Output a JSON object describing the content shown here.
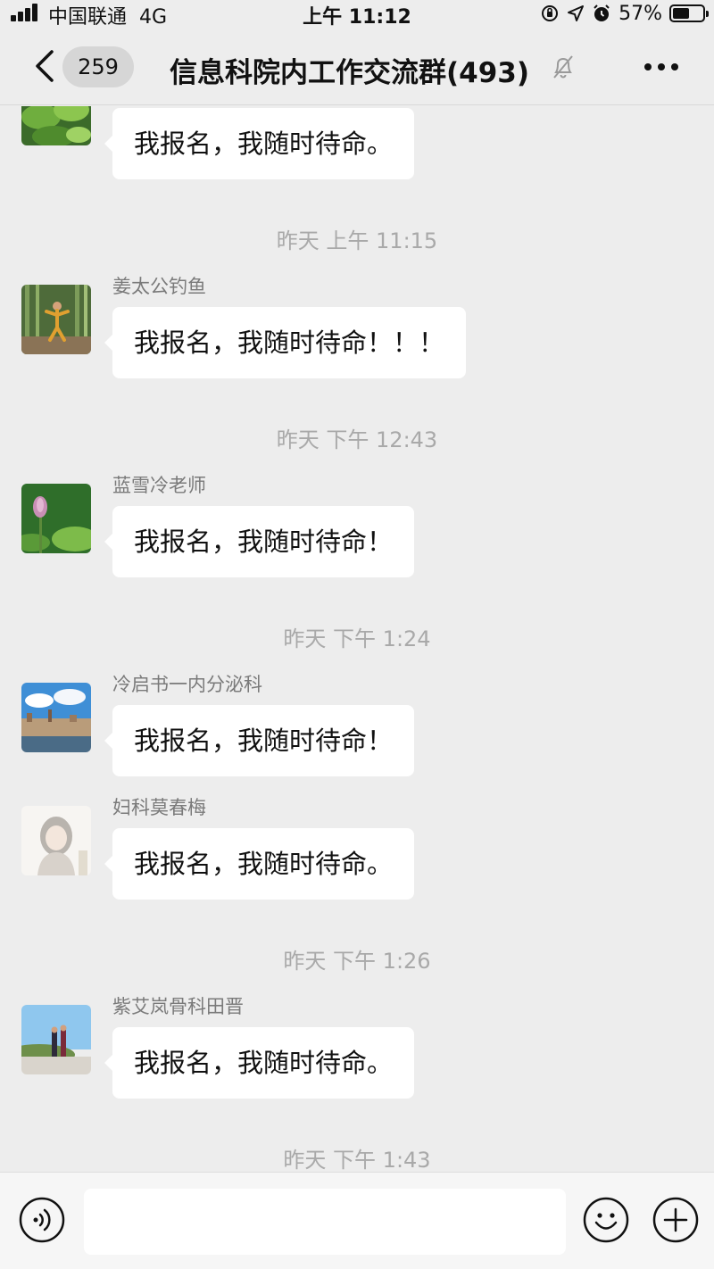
{
  "status_bar": {
    "carrier": "中国联通",
    "network": "4G",
    "time": "上午 11:12",
    "battery_percent_text": "57%",
    "battery_level": 0.57
  },
  "nav": {
    "unread_count": "259",
    "title": "信息科院内工作交流群(493)"
  },
  "messages": [
    {
      "text": "我报名，我随时待命。"
    },
    {
      "timestamp": "昨天 上午 11:15"
    },
    {
      "sender": "姜太公钓鱼",
      "text": "我报名，我随时待命！！！"
    },
    {
      "timestamp": "昨天 下午 12:43"
    },
    {
      "sender": "蓝雪冷老师",
      "text": "我报名，我随时待命！"
    },
    {
      "timestamp": "昨天 下午 1:24"
    },
    {
      "sender": "冷启书一内分泌科",
      "text": "我报名，我随时待命！"
    },
    {
      "sender": "妇科莫春梅",
      "text": "我报名，我随时待命。"
    },
    {
      "timestamp": "昨天 下午 1:26"
    },
    {
      "sender": "紫艾岚骨科田晋",
      "text": "我报名，我随时待命。"
    },
    {
      "timestamp": "昨天 下午 1:43"
    }
  ],
  "input": {
    "value": ""
  }
}
